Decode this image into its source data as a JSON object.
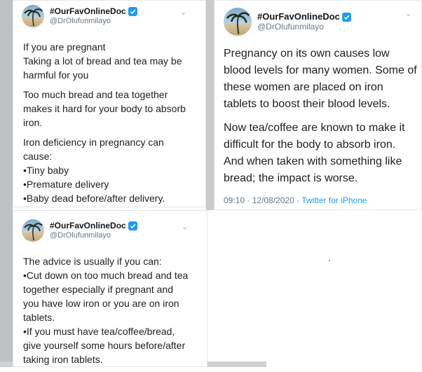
{
  "account": {
    "display_name": "#OurFavOnlineDoc",
    "handle": "@DrOlufunmilayo"
  },
  "tweets": [
    {
      "paragraphs": [
        [
          "If you are pregnant",
          "Taking a lot of bread and tea may be",
          "harmful for you"
        ],
        [
          "Too much bread and tea together",
          "makes it hard for your body to absorb",
          "iron."
        ],
        [
          "Iron deficiency in pregnancy can",
          "cause:",
          "•Tiny baby",
          "•Premature delivery",
          "•Baby dead before/after delivery."
        ]
      ]
    },
    {
      "paragraphs": [
        [
          "Pregnancy on its own causes low",
          "blood levels for many women. Some of",
          "these women are placed on iron",
          "tablets to boost their blood levels."
        ],
        [
          "Now tea/coffee are known to make it",
          "difficult for the body to absorb iron.",
          "And when taken with something like",
          "bread; the impact is worse."
        ]
      ],
      "time": "09:10 · 12/08/2020 · ",
      "source": "Twitter for iPhone"
    },
    {
      "paragraphs": [
        [
          "The advice is usually if you can:",
          "•Cut down on too much bread and tea",
          "together especially if pregnant and",
          "you have low iron or you are on iron",
          "tablets.",
          "•If you must have tea/coffee/bread,",
          "give yourself some hours before/after",
          "taking iron tablets."
        ]
      ]
    }
  ],
  "icons": {
    "verified": "verified-badge-icon",
    "chevron": "chevron-down-icon",
    "avatar": "palm-tree-avatar"
  },
  "colors": {
    "link": "#1d9bf0",
    "secondary_text": "#657786"
  }
}
